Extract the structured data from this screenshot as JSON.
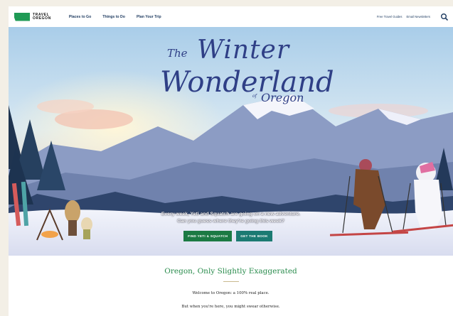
{
  "brand": {
    "logo_line1": "TRAVEL",
    "logo_line2": "OREGON",
    "color": "#1f9a55"
  },
  "nav": {
    "links": [
      "Places to Go",
      "Things to Do",
      "Plan Your Trip"
    ],
    "utility_links": [
      "Free Travel Guides",
      "Email Newsletters"
    ],
    "search_icon": "search-icon"
  },
  "hero": {
    "title_the": "The",
    "title_winter": "Winter",
    "title_wonderland": "Wonderland",
    "title_of": "of",
    "title_oregon": "Oregon",
    "caption_line1": "Every week, Yeti and Squatch are going on a new adventure.",
    "caption_line2": "Can you guess where they're going this week?",
    "button_primary": "FIND YETI & SQUATCH",
    "button_secondary": "GET THE BOOK"
  },
  "intro": {
    "heading": "Oregon, Only Slightly Exaggerated",
    "line1": "Welcome to Oregon: a 100% real place.",
    "line2": "But when you're here, you might swear otherwise."
  },
  "colors": {
    "button_green": "#1b7a43",
    "button_teal": "#1b7a72",
    "heading_green": "#2a8c4d",
    "title_blue": "#2f3f86"
  }
}
